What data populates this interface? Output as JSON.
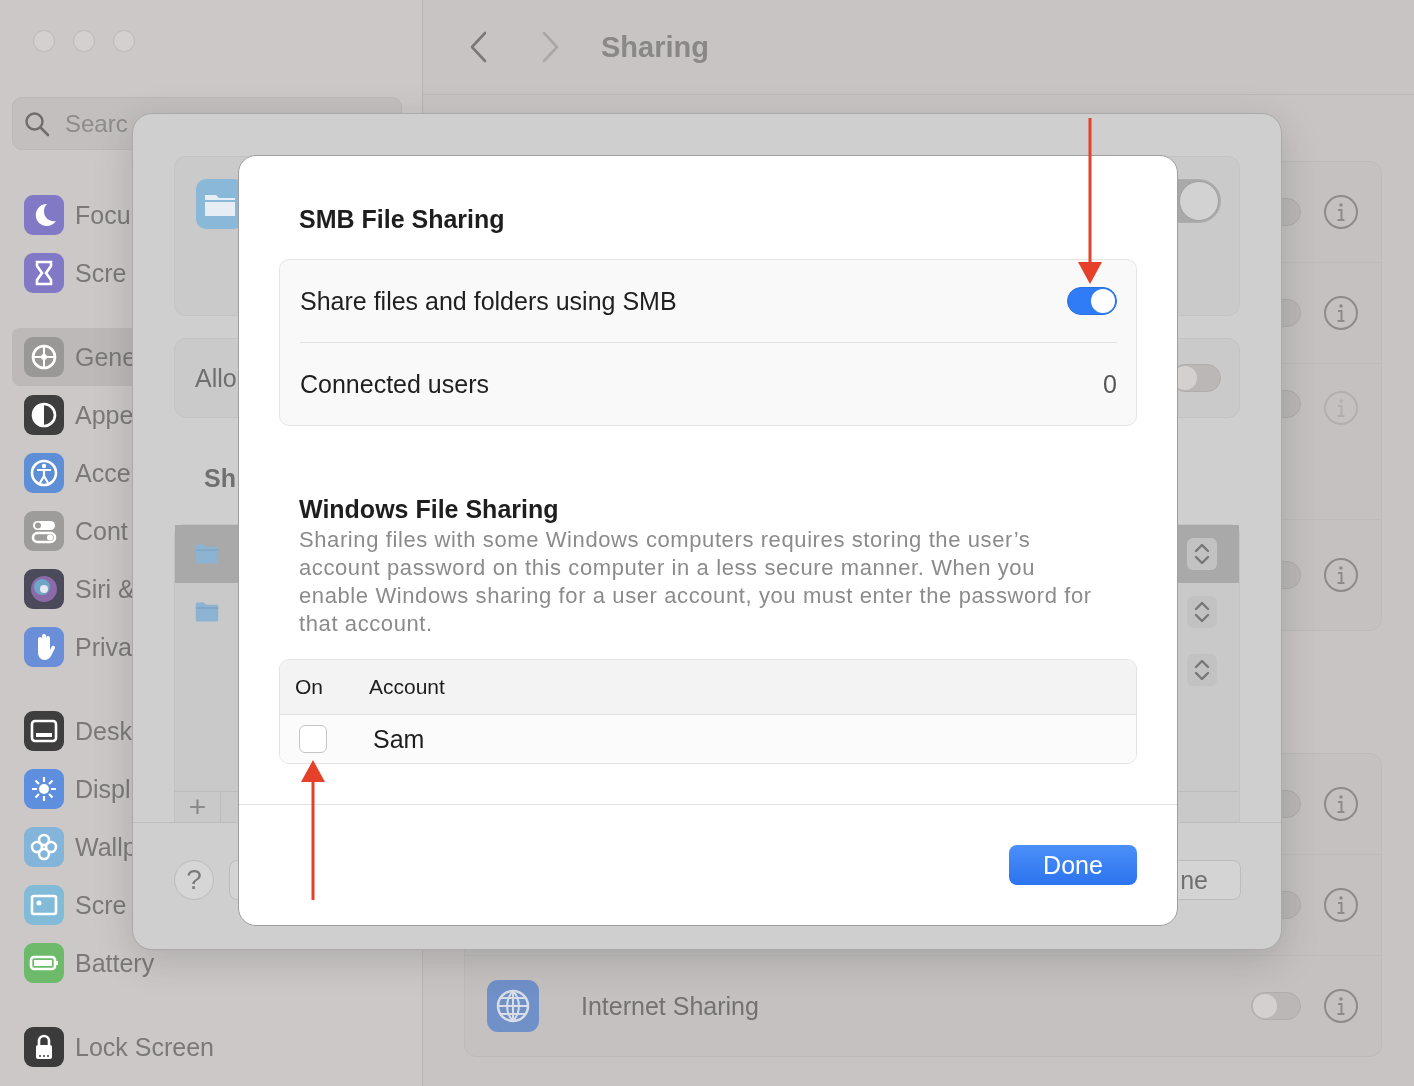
{
  "window": {
    "title": "Sharing",
    "back": {
      "disabled": false
    },
    "forward": {
      "disabled": true
    }
  },
  "sidebar": {
    "search": {
      "placeholder": "Searc"
    },
    "sections": [
      {
        "items": [
          {
            "label": "Focu",
            "selected": false
          },
          {
            "label": "Scre",
            "selected": false
          }
        ]
      },
      {
        "items": [
          {
            "label": "Gene",
            "selected": true
          },
          {
            "label": "Appe",
            "selected": false
          },
          {
            "label": "Acce",
            "selected": false
          },
          {
            "label": "Cont",
            "selected": false
          },
          {
            "label": "Siri &",
            "selected": false
          },
          {
            "label": "Priva",
            "selected": false
          }
        ]
      },
      {
        "items": [
          {
            "label": "Desk",
            "selected": false
          },
          {
            "label": "Displ",
            "selected": false
          },
          {
            "label": "Wallp",
            "selected": false
          },
          {
            "label": "Scre",
            "selected": false
          },
          {
            "label": "Battery",
            "selected": false
          }
        ]
      },
      {
        "items": [
          {
            "label": "Lock Screen",
            "selected": false
          }
        ]
      }
    ]
  },
  "main": {
    "groups": [
      {
        "rows": [
          {
            "on": false,
            "disabled": false
          },
          {
            "on": false,
            "disabled": false
          },
          {
            "on": false,
            "disabled": true
          },
          {
            "on": false,
            "disabled": false
          }
        ]
      },
      {
        "rows": [
          {
            "on": false,
            "disabled": false
          },
          {
            "on": false,
            "disabled": false
          },
          {
            "label": "Internet Sharing",
            "on": false,
            "disabled": false
          }
        ]
      }
    ]
  },
  "file_sharing_sheet": {
    "service_toggle": {
      "on": true
    },
    "allow_row": {
      "label": "Allo",
      "on": false
    },
    "shared_heading": "Sh",
    "shared_rows": [
      {
        "selected": true,
        "folder": true
      },
      {
        "selected": false,
        "folder": true
      },
      {
        "selected": false,
        "folder": false
      }
    ],
    "add_button": "+",
    "help_button": "?",
    "done_button": "ne"
  },
  "smb_dialog": {
    "title": "SMB File Sharing",
    "rows": [
      {
        "kind": "toggle",
        "label": "Share files and folders using SMB",
        "on": true
      },
      {
        "kind": "value",
        "label": "Connected users",
        "value": "0"
      }
    ],
    "windows_section": {
      "title": "Windows File Sharing",
      "description": "Sharing files with some Windows computers requires storing the user’s account password on this computer in a less secure manner. When you enable Windows sharing for a user account, you must enter the password for that account.",
      "columns": [
        "On",
        "Account"
      ],
      "accounts": [
        {
          "name": "Sam",
          "checked": false
        }
      ]
    },
    "done_button": "Done"
  }
}
